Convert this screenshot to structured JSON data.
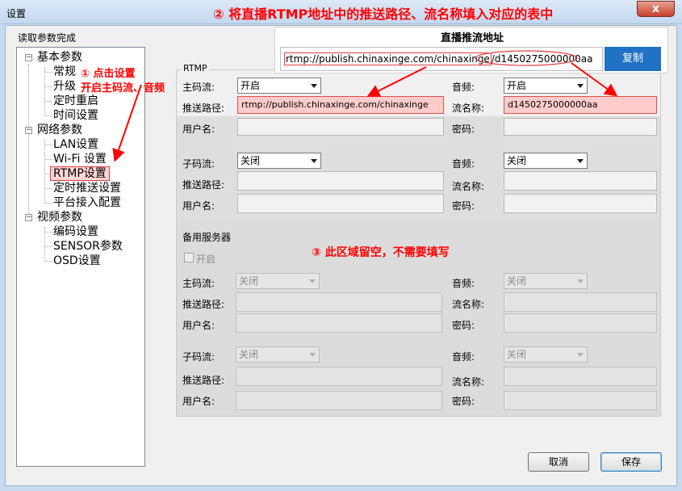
{
  "window": {
    "title": "设置",
    "close_glyph": "x"
  },
  "banner": "② 将直播RTMP地址中的推送路径、流名称填入对应的表中",
  "status": "读取参数完成",
  "tree": {
    "basic": "基本参数",
    "general": "常规",
    "upgrade": "升级",
    "reboot": "定时重启",
    "time": "时间设置",
    "network": "网络参数",
    "lan": "LAN设置",
    "wifi": "Wi-Fi 设置",
    "rtmp": "RTMP设置",
    "timed_push": "定时推送设置",
    "platform": "平台接入配置",
    "video": "视频参数",
    "encode": "编码设置",
    "sensor": "SENSOR参数",
    "osd": "OSD设置",
    "expand_glyph": "−"
  },
  "annotations": {
    "step1_line1": "① 点击设置",
    "step1_line2": "开启主码流、音频",
    "step3": "③ 此区域留空，不需要填写"
  },
  "popup": {
    "title": "直播推流地址",
    "url_path": "rtmp://publish.chinaxinge.com/chinaxinge",
    "url_sep": "/",
    "url_stream": "d1450275000000aa",
    "copy": "复制"
  },
  "rtmp": {
    "group_label": "RTMP",
    "main": {
      "main_stream_label": "主码流:",
      "main_stream_value": "开启",
      "audio_label": "音频:",
      "audio_value": "开启",
      "push_path_label": "推送路径:",
      "push_path_value": "rtmp://publish.chinaxinge.com/chinaxinge",
      "stream_name_label": "流名称:",
      "stream_name_value": "d1450275000000aa",
      "username_label": "用户名:",
      "password_label": "密码:"
    },
    "sub": {
      "sub_stream_label": "子码流:",
      "sub_stream_value": "关闭",
      "audio_label": "音频:",
      "audio_value": "关闭",
      "push_path_label": "推送路径:",
      "stream_name_label": "流名称:",
      "username_label": "用户名:",
      "password_label": "密码:"
    }
  },
  "backup": {
    "group_label": "备用服务器",
    "enable_label": "开启",
    "block1": {
      "stream_label": "主码流:",
      "stream_value": "关闭",
      "audio_label": "音频:",
      "audio_value": "关闭",
      "push_path_label": "推送路径:",
      "stream_name_label": "流名称:",
      "username_label": "用户名:",
      "password_label": "密码:"
    },
    "block2": {
      "stream_label": "子码流:",
      "stream_value": "关闭",
      "audio_label": "音频:",
      "audio_value": "关闭",
      "push_path_label": "推送路径:",
      "stream_name_label": "流名称:",
      "username_label": "用户名:",
      "password_label": "密码:"
    }
  },
  "buttons": {
    "cancel": "取消",
    "save": "保存"
  },
  "colors": {
    "annotation": "#ff0000",
    "highlight_fill": "#ffcccc",
    "copy_button": "#1f72c4",
    "window_frame": "#c7dbf0"
  }
}
